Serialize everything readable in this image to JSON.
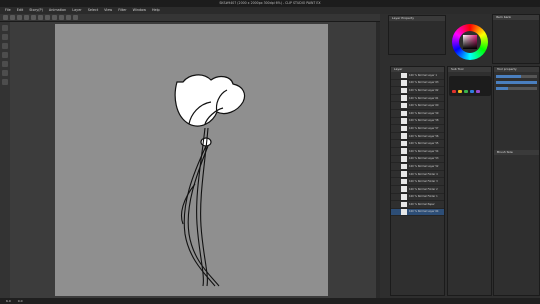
{
  "window": {
    "title": "SKS#9407 (2000 x 2000px 300dpi 6%) - CLIP STUDIO PAINT EX"
  },
  "menu": [
    "File",
    "Edit",
    "Story(P)",
    "Animation",
    "Layer",
    "Select",
    "View",
    "Filter",
    "Window",
    "Help"
  ],
  "panels": {
    "layer_property": "Layer Property",
    "color_wheel": "Color Wheel",
    "layer": "Layer",
    "sub_tool": "Sub Tool",
    "tool_property": "Tool property",
    "navigator": "Item bank",
    "brush_size": "Brush Size"
  },
  "layers": [
    {
      "name": "100 % Normal Layer 1",
      "selected": false
    },
    {
      "name": "100 % Normal Layer 63",
      "selected": false
    },
    {
      "name": "100 % Normal Layer 62",
      "selected": false
    },
    {
      "name": "100 % Normal Layer 61",
      "selected": false
    },
    {
      "name": "100 % Normal Layer 60",
      "selected": false
    },
    {
      "name": "100 % Normal Layer 59",
      "selected": false
    },
    {
      "name": "100 % Normal Layer 58",
      "selected": false
    },
    {
      "name": "100 % Normal Layer 57",
      "selected": false
    },
    {
      "name": "100 % Normal Layer 56",
      "selected": false
    },
    {
      "name": "100 % Normal Layer 55",
      "selected": false
    },
    {
      "name": "100 % Normal Layer 54",
      "selected": false
    },
    {
      "name": "100 % Normal Layer 53",
      "selected": false
    },
    {
      "name": "100 % Normal Layer 52",
      "selected": false
    },
    {
      "name": "100 % Normal Folder 4",
      "selected": false
    },
    {
      "name": "100 % Normal Folder 3",
      "selected": false
    },
    {
      "name": "100 % Normal Folder 2",
      "selected": false
    },
    {
      "name": "100 % Normal Folder 1",
      "selected": false
    },
    {
      "name": "100 % Normal Paper",
      "selected": false
    },
    {
      "name": "100 % Normal Layer 64",
      "selected": true
    }
  ],
  "status": {
    "zoom": "6.0",
    "angle": "0.0"
  },
  "colors": {
    "accent": "#2d4e77",
    "canvas": "#8f8f8f"
  }
}
